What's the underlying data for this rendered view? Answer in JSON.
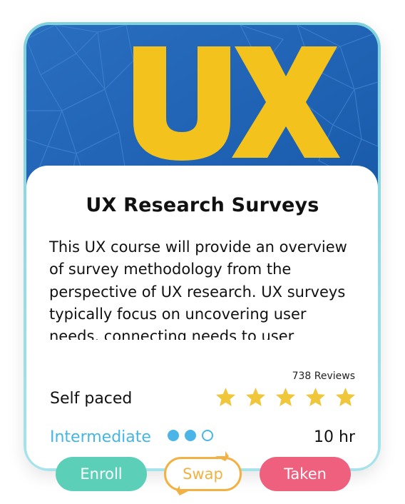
{
  "course": {
    "image_text": "UX",
    "title": "UX Research Surveys",
    "description": "This UX course will provide an overview of survey methodology from the perspective of UX research. UX surveys typically focus on uncovering user needs, connecting needs to user",
    "reviews": "738 Reviews",
    "rating": 5,
    "pace": "Self paced",
    "level": "Intermediate",
    "level_dots": [
      true,
      true,
      false
    ],
    "duration": "10 hr"
  },
  "actions": {
    "enroll_label": "Enroll",
    "swap_label": "Swap",
    "taken_label": "Taken"
  },
  "colors": {
    "card_border": "#7fd1db",
    "hero_blue": "#1e64b4",
    "logo_yellow": "#f3c21c",
    "star_yellow": "#f0c63a",
    "level_blue": "#45b6e3",
    "enroll": "#5ccfb8",
    "swap": "#f2b143",
    "taken": "#ef5f7e"
  },
  "icons": {
    "star": "star-icon",
    "swap": "swap-arrows-icon"
  }
}
